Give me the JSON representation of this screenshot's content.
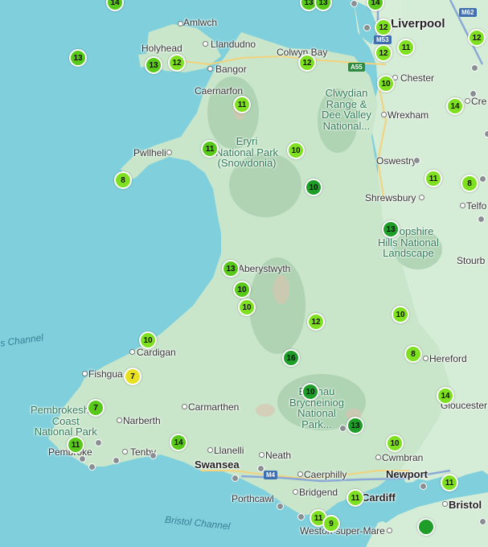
{
  "colors": {
    "sea": "#7fd0dc",
    "land": "#cfe9d2",
    "high_value": "#7ee020",
    "mid_value": "#58c81a",
    "low_value": "#1e9e28",
    "peak_value": "#e8e022"
  },
  "labels": {
    "liverpool": "Liverpool",
    "amlwch": "Amlwch",
    "holyhead": "Holyhead",
    "llandudno": "Llandudno",
    "colwyn_bay": "Colwyn Bay",
    "bangor": "Bangor",
    "caernarfon": "Caernarfon",
    "chester": "Chester",
    "clwydian": "Clwydian\nRange &\nDee Valley\nNational...",
    "wrexham": "Wrexham",
    "cre": "Cre",
    "pwllheli": "Pwllheli",
    "eryri": "Eryri\nNational Park\n(Snowdonia)",
    "oswestry": "Oswestry",
    "shrewsbury": "Shrewsbury",
    "telford": "Telfo",
    "shropshire": "Shropshire\nHills National\nLandscape",
    "stourbridge": "Stourb",
    "aberystwyth": "Aberystwyth",
    "cardigan": "Cardigan",
    "fishguard": "Fishgua",
    "hereford": "Hereford",
    "bannau": "Bannau\nBrycheiniog\nNational\nPark...",
    "gloucester": "Gloucester",
    "pembrokeshire": "Pembrokeshire\nCoast\nNational Park",
    "narberth": "Narberth",
    "carmarthen": "Carmarthen",
    "pembroke": "Pembroke",
    "tenby": "Tenby",
    "llanelli": "Llanelli",
    "swansea": "Swansea",
    "neath": "Neath",
    "cwmbran": "Cwmbran",
    "newport": "Newport",
    "caerphilly": "Caerphilly",
    "bridgend": "Bridgend",
    "cardiff": "Cardiff",
    "porthcawl": "Porthcawl",
    "bristol": "Bristol",
    "weston": "Weston-super-Mare",
    "irish_channel": "s Channel",
    "bristol_channel": "Bristol Channel"
  },
  "roads": {
    "m62": "M62",
    "m53": "M53",
    "a55": "A55",
    "m4": "M4"
  },
  "markers": [
    {
      "value": "14"
    },
    {
      "value": "13"
    },
    {
      "value": "13"
    },
    {
      "value": "14"
    },
    {
      "value": "12"
    },
    {
      "value": "11"
    },
    {
      "value": "12"
    },
    {
      "value": "13"
    },
    {
      "value": "13"
    },
    {
      "value": "12"
    },
    {
      "value": "12"
    },
    {
      "value": "12"
    },
    {
      "value": "10"
    },
    {
      "value": "11"
    },
    {
      "value": "14"
    },
    {
      "value": "10"
    },
    {
      "value": "11"
    },
    {
      "value": "8"
    },
    {
      "value": "10"
    },
    {
      "value": "11"
    },
    {
      "value": "8"
    },
    {
      "value": "13"
    },
    {
      "value": "13"
    },
    {
      "value": "10"
    },
    {
      "value": "10"
    },
    {
      "value": "10"
    },
    {
      "value": "12"
    },
    {
      "value": "10"
    },
    {
      "value": "8"
    },
    {
      "value": "16"
    },
    {
      "value": "7"
    },
    {
      "value": "10"
    },
    {
      "value": "14"
    },
    {
      "value": "7"
    },
    {
      "value": "13"
    },
    {
      "value": "14"
    },
    {
      "value": "10"
    },
    {
      "value": "11"
    },
    {
      "value": "11"
    },
    {
      "value": "11"
    },
    {
      "value": "11"
    },
    {
      "value": "9"
    }
  ]
}
